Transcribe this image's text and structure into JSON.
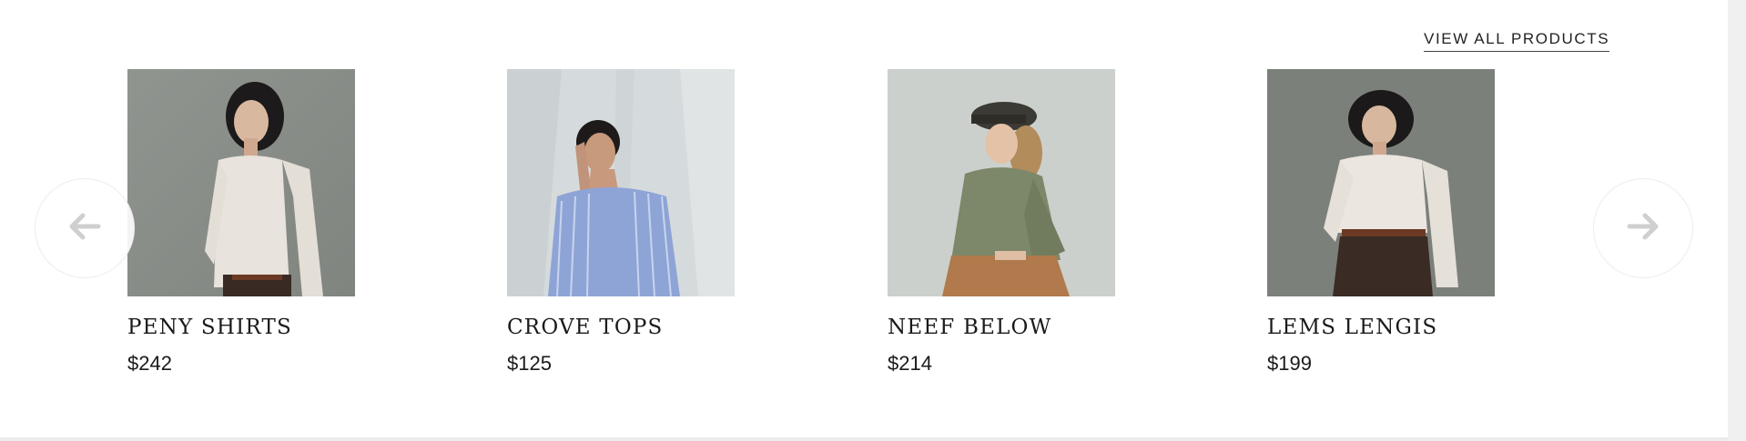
{
  "view_all_label": "VIEW ALL PRODUCTS",
  "nav": {
    "prev_icon": "arrow-left-icon",
    "next_icon": "arrow-right-icon"
  },
  "products": [
    {
      "name": "PENY SHIRTS",
      "price": "$242"
    },
    {
      "name": "CROVE TOPS",
      "price": "$125"
    },
    {
      "name": "NEEF BELOW",
      "price": "$214"
    },
    {
      "name": "LEMS LENGIS",
      "price": "$199"
    }
  ],
  "colors": {
    "text": "#1a1a1a",
    "arrow": "#cfcfcf",
    "arrow_border": "#ececec"
  }
}
